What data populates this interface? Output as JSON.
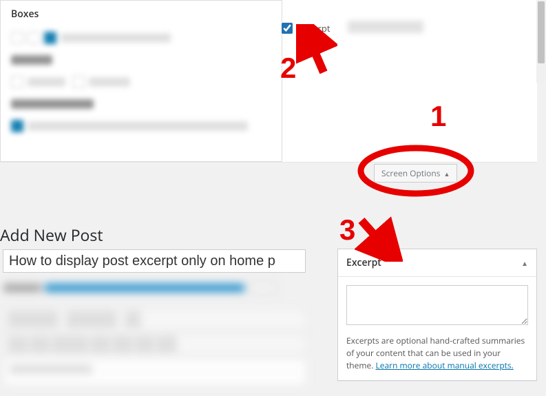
{
  "screen_options_panel": {
    "heading": "Boxes",
    "excerpt_checkbox_label": "Excerpt"
  },
  "screen_options_toggle": "Screen Options",
  "page": {
    "title": "Add New Post",
    "post_title_value": "How to display post excerpt only on home p"
  },
  "excerpt_metabox": {
    "title": "Excerpt",
    "textarea_value": "",
    "help_text": "Excerpts are optional hand-crafted summaries of your content that can be used in your theme. ",
    "help_link_text": "Learn more about manual excerpts."
  },
  "annotations": {
    "one": "1",
    "two": "2",
    "three": "3"
  }
}
